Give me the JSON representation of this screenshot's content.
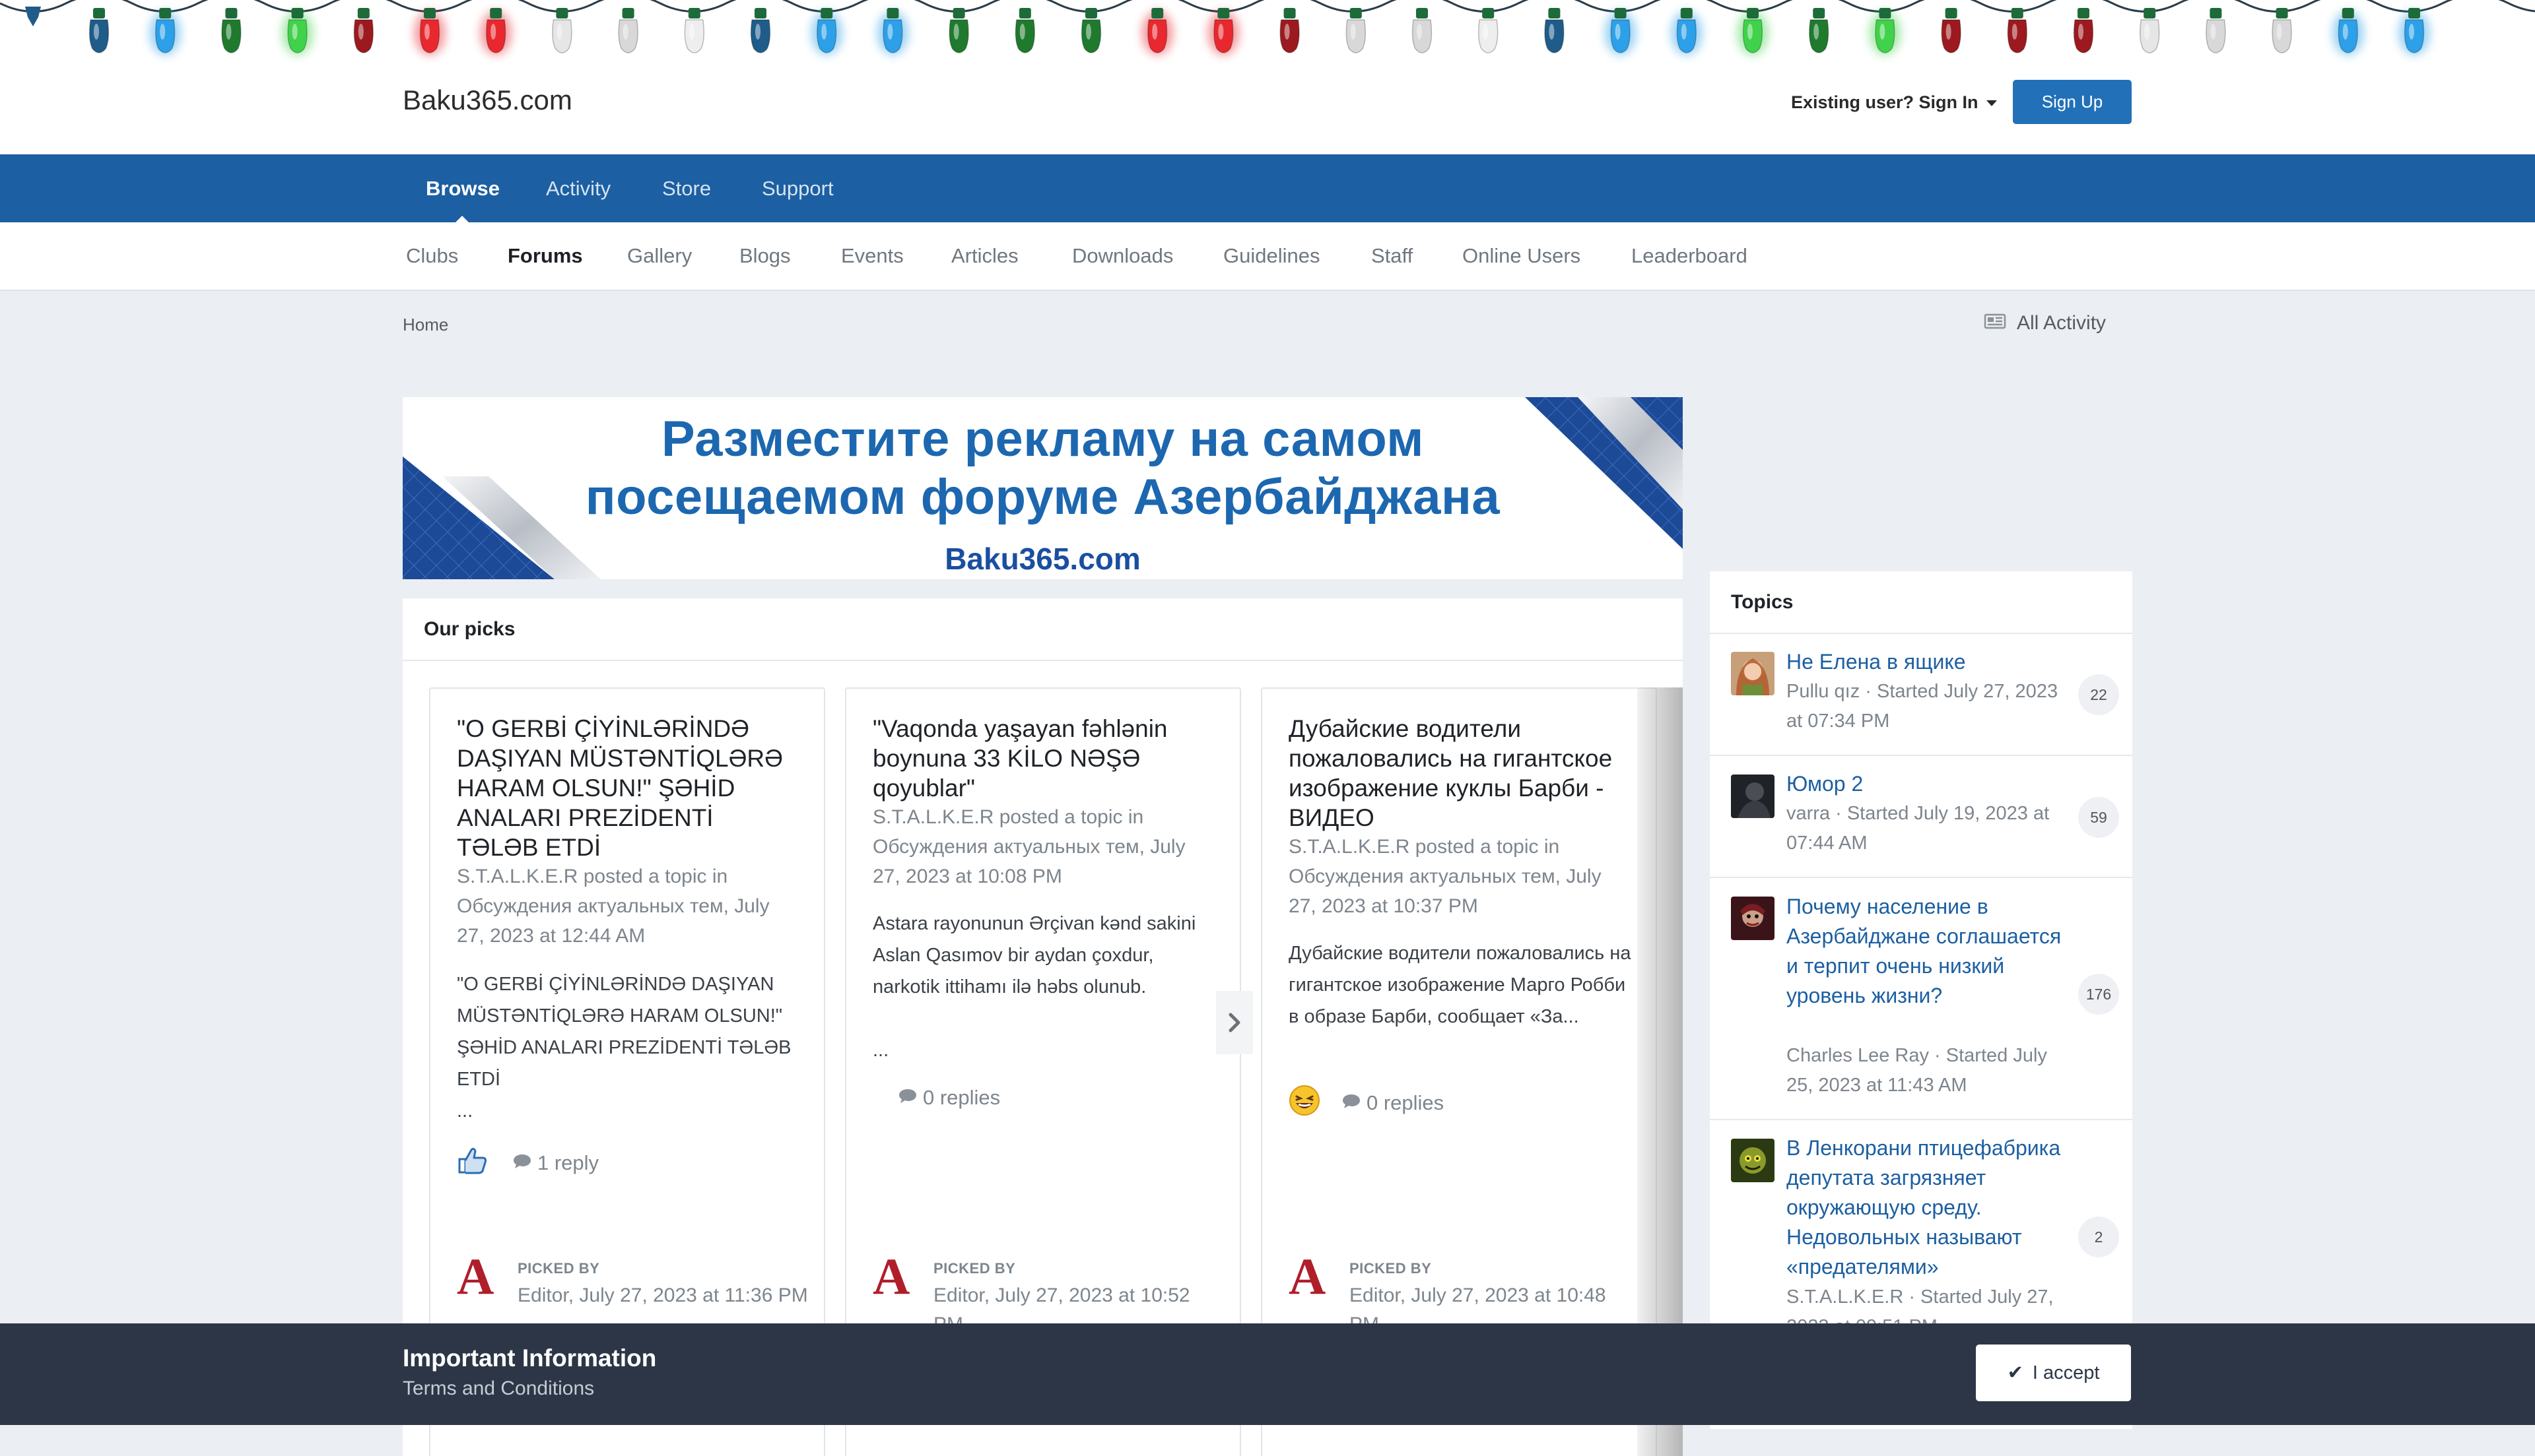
{
  "site": {
    "title": "Baku365.com"
  },
  "header": {
    "signin_label": "Existing user? Sign In",
    "signup_label": "Sign Up"
  },
  "primary_nav": [
    "Browse",
    "Activity",
    "Store",
    "Support"
  ],
  "secondary_nav": [
    "Clubs",
    "Forums",
    "Gallery",
    "Blogs",
    "Events",
    "Articles",
    "Downloads",
    "Guidelines",
    "Staff",
    "Online Users",
    "Leaderboard"
  ],
  "breadcrumb": {
    "home": "Home",
    "all_activity": "All Activity"
  },
  "ad": {
    "line1": "Разместите рекламу на самом",
    "line2": "посещаемом форуме Азербайджана",
    "brand": "Baku365.com"
  },
  "picks": {
    "title": "Our picks",
    "picked_by_label": "PICKED BY",
    "cards": [
      {
        "title": "\"O GERBİ ÇİYİNLƏRİNDƏ DAŞIYAN MÜSTƏNTİQLƏRƏ HARAM OLSUN!\" ŞƏHİD ANALARI PREZİDENTİ TƏLƏB ETDİ",
        "meta": "S.T.A.L.K.E.R posted a topic in Обсуждения актуальных тем, July 27, 2023 at 12:44 AM",
        "body": "\"O GERBİ ÇİYİNLƏRİNDƏ DAŞIYAN MÜSTƏNTİQLƏRƏ HARAM OLSUN!\" ŞƏHİD ANALARI PREZİDENTİ TƏLƏB ETDİ",
        "ellipsis": "...",
        "replies": "1 reply",
        "reaction_icon": "thumbs-up-icon",
        "picked_meta": "Editor, July 27, 2023 at 11:36 PM"
      },
      {
        "title": "\"Vaqonda yaşayan fəhlənin boynuna 33 KİLO NƏŞƏ qoyublar\"",
        "meta": "S.T.A.L.K.E.R posted a topic in Обсуждения актуальных тем, July 27, 2023 at 10:08 PM",
        "body": "Astara rayonunun Ərçivan kənd sakini Aslan Qasımov bir aydan çoxdur, narkotik ittihamı ilə həbs olunub.",
        "ellipsis": "...",
        "replies": "0 replies",
        "reaction_icon": "",
        "picked_meta": "Editor, July 27, 2023 at 10:52 PM"
      },
      {
        "title": "Дубайские водители пожаловались на гигантское изображение куклы Барби - ВИДЕО",
        "meta": "S.T.A.L.K.E.R posted a topic in Обсуждения актуальных тем, July 27, 2023 at 10:37 PM",
        "body": "Дубайские водители пожаловались на гигантское изображение Марго Робби в образе Барби, сообщает «За...",
        "ellipsis": "",
        "replies": "0 replies",
        "reaction_icon": "laughing-emoji-icon",
        "picked_meta": "Editor, July 27, 2023 at 10:48 PM"
      }
    ]
  },
  "topics": {
    "title": "Topics",
    "items": [
      {
        "title": "Не Елена в ящике",
        "meta": "Pullu qız · Started July 27, 2023 at 07:34 PM",
        "count": "22"
      },
      {
        "title": "Юмор 2",
        "meta": "varra · Started July 19, 2023 at 07:44 AM",
        "count": "59"
      },
      {
        "title": "Почему население в Азербайджане соглашается и терпит очень низкий уровень жизни?",
        "meta": "Charles Lee Ray · Started July 25, 2023 at 11:43 AM",
        "count": "176"
      },
      {
        "title": "В Ленкорани птицефабрика депутата загрязняет окружающую среду. Недовольных называют «предателями»",
        "meta": "S.T.A.L.K.E.R · Started July 27, 2023 at 09:51 PM",
        "count": "2"
      }
    ]
  },
  "bottom_bar": {
    "title": "Important Information",
    "link": "Terms and Conditions",
    "accept_label": "I accept"
  },
  "colors": {
    "primary_nav_bg": "#1c5fa2",
    "accent_button": "#2271b8",
    "link": "#1c5fa2",
    "bottom_bar_bg": "#2d3646",
    "page_bg": "#ebeef2"
  }
}
